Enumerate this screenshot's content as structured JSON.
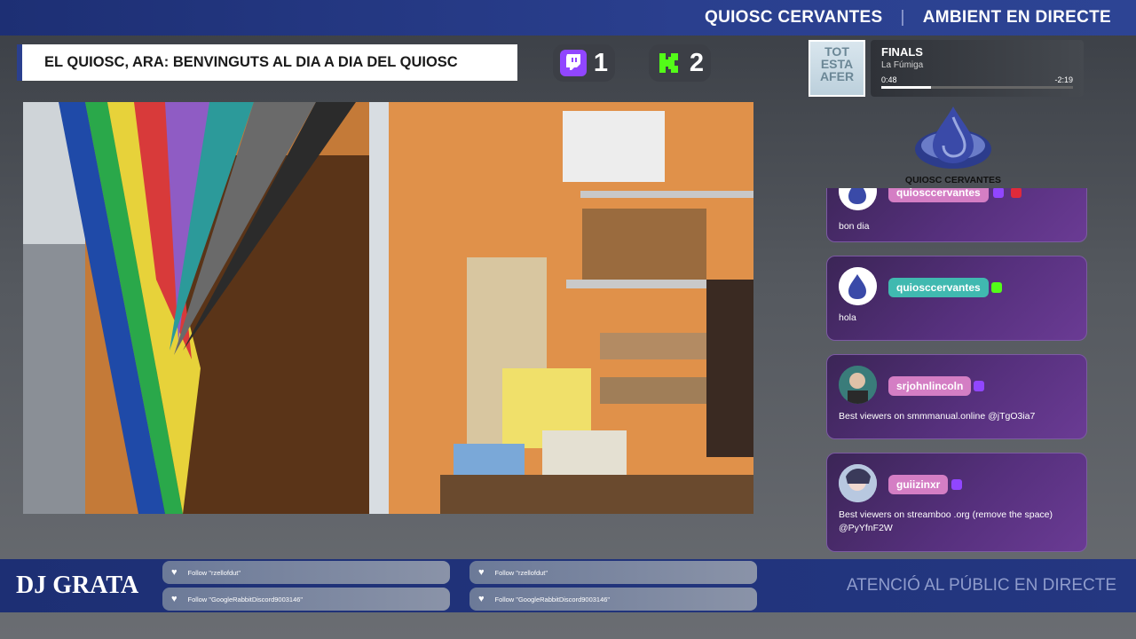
{
  "header": {
    "brand": "QUIOSC CERVANTES",
    "separator": "|",
    "subtitle": "AMBIENT EN DIRECTE"
  },
  "title_box": "EL QUIOSC, ARA: BENVINGUTS AL DIA A DIA DEL QUIOSC",
  "counters": [
    {
      "platform": "twitch-icon",
      "value": "1",
      "color": "#9146ff"
    },
    {
      "platform": "kick-icon",
      "value": "2",
      "color": "#53fc18"
    }
  ],
  "music": {
    "album_art_text": "TOT ESTA AFER",
    "song": "FINALS",
    "artist": "La Fúmiga",
    "elapsed": "0:48",
    "remaining": "-2:19",
    "progress": 0.26
  },
  "logo": {
    "text": "QUIOSC CERVANTES",
    "icon": "drop-logo-icon"
  },
  "chat": [
    {
      "user": "quiosccervantes",
      "text": "bon dia",
      "name_color": "#d47ec4",
      "badge": "twitch",
      "avatar": "logo"
    },
    {
      "user": "quiosccervantes",
      "text": "hola",
      "name_color": "#40b9b0",
      "badge": "kick",
      "avatar": "logo"
    },
    {
      "user": "srjohnlincoln",
      "text": "Best viewers on smmmanual.online @jTgO3ia7",
      "name_color": "#d47ec4",
      "badge": "twitch",
      "avatar": "person"
    },
    {
      "user": "guiizinxr",
      "text": "Best viewers on streamboo .org (remove the space) @PyYfnF2W",
      "name_color": "#d47ec4",
      "badge": "twitch",
      "avatar": "anime"
    }
  ],
  "bottom": {
    "dj": "DJ GRATA",
    "follows": [
      "Follow \"rzellofdut\"",
      "Follow \"GoogleRabbitDiscord9003146\"",
      "Follow \"rzellofdut\"",
      "Follow \"GoogleRabbitDiscord9003146\""
    ],
    "right_text": "ATENCIÓ AL PÚBLIC EN DIRECTE"
  },
  "colors": {
    "brand_blue": "#2a3f8e",
    "chat_purple": "#56307d"
  }
}
